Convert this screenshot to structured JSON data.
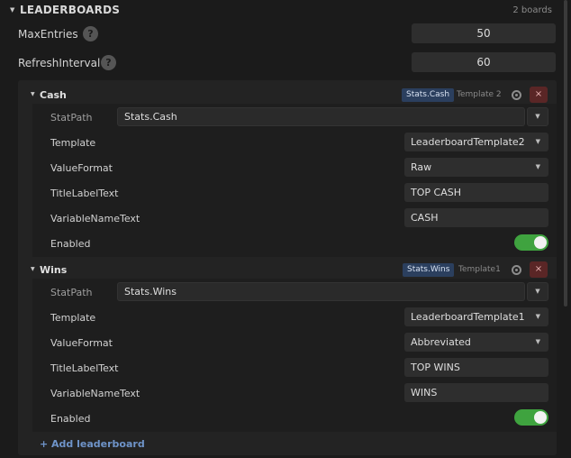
{
  "section": {
    "title": "LEADERBOARDS",
    "count": "2 boards"
  },
  "settings": [
    {
      "label": "MaxEntries",
      "help": "?",
      "value": "50"
    },
    {
      "label": "RefreshInterval",
      "help": "?",
      "value": "60"
    }
  ],
  "leaderboards": [
    {
      "name": "Cash",
      "badge": "Stats.Cash",
      "template_text": "Template 2",
      "delete": "×",
      "stat_path_label": "StatPath",
      "stat_path": "Stats.Cash",
      "template_label": "Template",
      "template": "LeaderboardTemplate2",
      "value_format_label": "ValueFormat",
      "value_format": "Raw",
      "title_label_label": "TitleLabelText",
      "title_label": "TOP CASH",
      "variable_name_label": "VariableNameText",
      "variable_name": "CASH",
      "enabled_label": "Enabled",
      "enabled": true
    },
    {
      "name": "Wins",
      "badge": "Stats.Wins",
      "template_text": "Template1",
      "delete": "×",
      "stat_path_label": "StatPath",
      "stat_path": "Stats.Wins",
      "template_label": "Template",
      "template": "LeaderboardTemplate1",
      "value_format_label": "ValueFormat",
      "value_format": "Abbreviated",
      "title_label_label": "TitleLabelText",
      "title_label": "TOP WINS",
      "variable_name_label": "VariableNameText",
      "variable_name": "WINS",
      "enabled_label": "Enabled",
      "enabled": true
    }
  ],
  "add_label": "+ Add leaderboard",
  "icons": {
    "collapse": "chevron-down-icon",
    "gear": "gear-icon",
    "delete": "close-icon",
    "dropdown": "chevron-down-icon"
  },
  "colors": {
    "accent": "#3fa33f",
    "badge": "#2b3f5e",
    "delete": "#5a2626",
    "link": "#6f94c9"
  }
}
